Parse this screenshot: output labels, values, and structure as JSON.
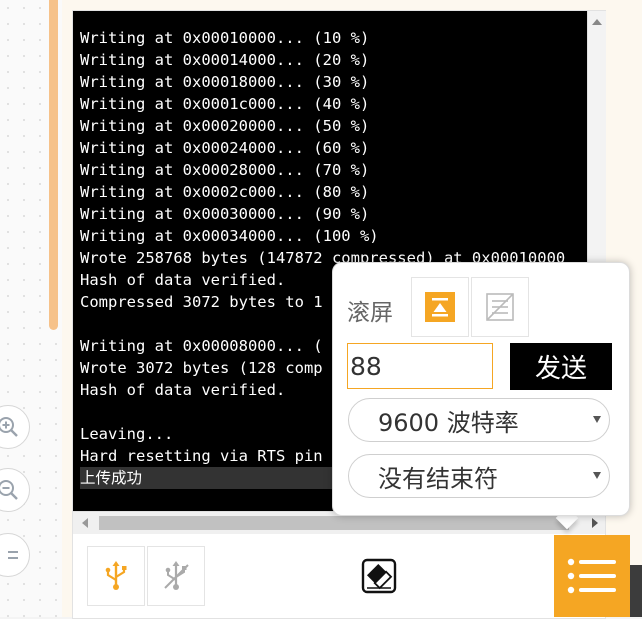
{
  "console": {
    "lines": [
      "Writing at 0x00010000... (10 %)",
      "Writing at 0x00014000... (20 %)",
      "Writing at 0x00018000... (30 %)",
      "Writing at 0x0001c000... (40 %)",
      "Writing at 0x00020000... (50 %)",
      "Writing at 0x00024000... (60 %)",
      "Writing at 0x00028000... (70 %)",
      "Writing at 0x0002c000... (80 %)",
      "Writing at 0x00030000... (90 %)",
      "Writing at 0x00034000... (100 %)",
      "Wrote 258768 bytes (147872 compressed) at 0x00010000",
      "Hash of data verified.",
      "Compressed 3072 bytes to 1",
      "",
      "Writing at 0x00008000... (",
      "Wrote 3072 bytes (128 comp",
      "Hash of data verified.",
      "",
      "Leaving...",
      "Hard resetting via RTS pin"
    ],
    "status_line": "上传成功"
  },
  "popup": {
    "scroll_label": "滚屏",
    "send_input_value": "88",
    "send_button_label": "发送",
    "baud_rate_selected": "9600 波特率",
    "line_ending_selected": "没有结束符"
  },
  "colors": {
    "accent": "#f5a623",
    "console_bg": "#000000",
    "console_text": "#ffffff"
  },
  "icons": {
    "zoom_in": "zoom-in-icon",
    "zoom_out": "zoom-out-icon",
    "usb_connect": "usb-icon",
    "usb_disconnect": "usb-off-icon",
    "clear": "eraser-icon",
    "menu": "list-menu-icon"
  }
}
